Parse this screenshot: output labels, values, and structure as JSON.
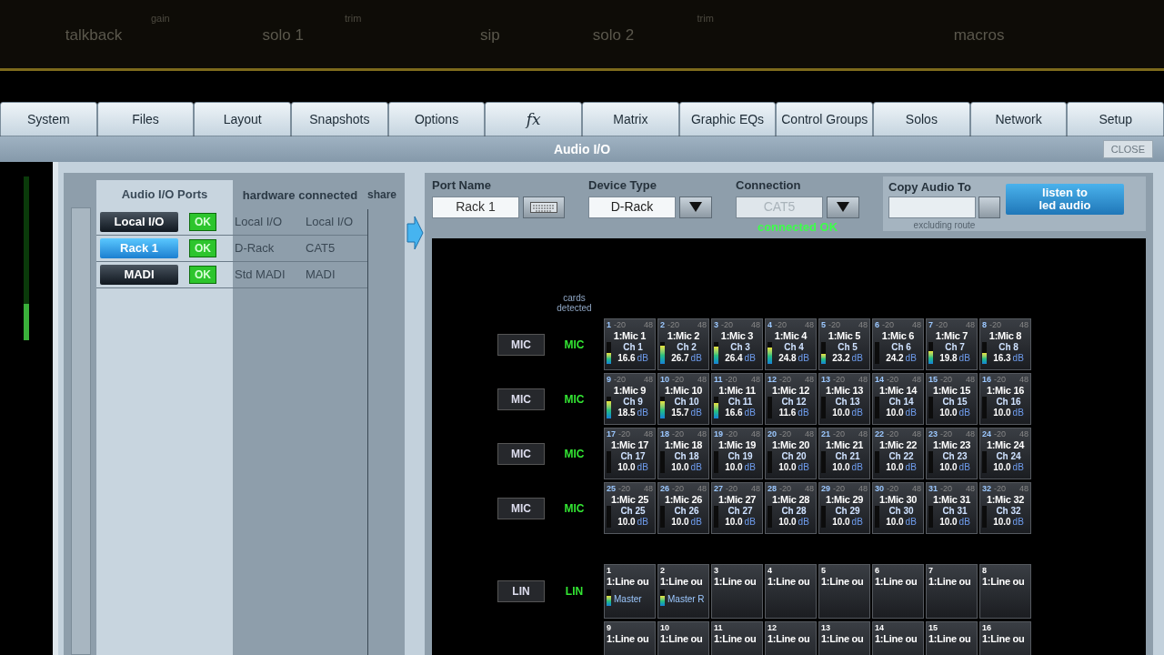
{
  "bezel": {
    "labels": [
      {
        "text": "talkback",
        "kind": "main"
      },
      {
        "text": "gain",
        "kind": "small"
      },
      {
        "text": "solo 1",
        "kind": "main"
      },
      {
        "text": "trim",
        "kind": "small"
      },
      {
        "text": "sip",
        "kind": "main"
      },
      {
        "text": "solo 2",
        "kind": "main"
      },
      {
        "text": "trim",
        "kind": "small"
      },
      {
        "text": "macros",
        "kind": "main"
      }
    ]
  },
  "tabs": [
    {
      "label": "System",
      "selected": false
    },
    {
      "label": "Files",
      "selected": false
    },
    {
      "label": "Layout",
      "selected": false
    },
    {
      "label": "Snapshots",
      "selected": false
    },
    {
      "label": "Options",
      "selected": false
    },
    {
      "label": "fx",
      "selected": false,
      "kind": "italic"
    },
    {
      "label": "Matrix",
      "selected": false
    },
    {
      "label": "Graphic EQs",
      "selected": false
    },
    {
      "label": "Control Groups",
      "selected": false
    },
    {
      "label": "Solos",
      "selected": false
    },
    {
      "label": "Network",
      "selected": false
    },
    {
      "label": "Setup",
      "selected": false
    }
  ],
  "window": {
    "title": "Audio I/O",
    "close": "CLOSE"
  },
  "ports": {
    "columns": [
      "Audio I/O Ports",
      "hardware connected",
      "share"
    ],
    "rows": [
      {
        "name": "Local I/O",
        "selected": false,
        "status": "OK",
        "device": "Local I/O",
        "connection": "Local I/O"
      },
      {
        "name": "Rack 1",
        "selected": true,
        "status": "OK",
        "device": "D-Rack",
        "connection": "CAT5"
      },
      {
        "name": "MADI",
        "selected": false,
        "status": "OK",
        "device": "Std MADI",
        "connection": "MADI"
      }
    ]
  },
  "port_name": {
    "label": "Port Name",
    "value": "Rack 1"
  },
  "device_type": {
    "label": "Device Type",
    "value": "D-Rack"
  },
  "connection": {
    "label": "Connection",
    "value": "CAT5",
    "disabled": true,
    "status": "connected OK"
  },
  "copy_audio_to": {
    "label": "Copy Audio To",
    "note": "excluding route"
  },
  "listen_button": {
    "lines": [
      "listen to",
      "led audio"
    ]
  },
  "cards_detected": "cards detected",
  "mic_rows": [
    {
      "button": "MIC",
      "detected": "MIC",
      "tiles": [
        {
          "num": "1",
          "low": "-20",
          "high": "48",
          "name": "1:Mic 1",
          "ch": "Ch 1",
          "value": "16.6",
          "unit": "dB",
          "level": 0.5
        },
        {
          "num": "2",
          "low": "-20",
          "high": "48",
          "name": "1:Mic 2",
          "ch": "Ch 2",
          "value": "26.7",
          "unit": "dB",
          "level": 0.85
        },
        {
          "num": "3",
          "low": "-20",
          "high": "48",
          "name": "1:Mic 3",
          "ch": "Ch 3",
          "value": "26.4",
          "unit": "dB",
          "level": 0.8
        },
        {
          "num": "4",
          "low": "-20",
          "high": "48",
          "name": "1:Mic 4",
          "ch": "Ch 4",
          "value": "24.8",
          "unit": "dB",
          "level": 0.75
        },
        {
          "num": "5",
          "low": "-20",
          "high": "48",
          "name": "1:Mic 5",
          "ch": "Ch 5",
          "value": "23.2",
          "unit": "dB",
          "level": 0.45
        },
        {
          "num": "6",
          "low": "-20",
          "high": "48",
          "name": "1:Mic 6",
          "ch": "Ch 6",
          "value": "24.2",
          "unit": "dB"
        },
        {
          "num": "7",
          "low": "-20",
          "high": "48",
          "name": "1:Mic 7",
          "ch": "Ch 7",
          "value": "19.8",
          "unit": "dB",
          "level": 0.6
        },
        {
          "num": "8",
          "low": "-20",
          "high": "48",
          "name": "1:Mic 8",
          "ch": "Ch 8",
          "value": "16.3",
          "unit": "dB",
          "level": 0.5
        }
      ]
    },
    {
      "button": "MIC",
      "detected": "MIC",
      "tiles": [
        {
          "num": "9",
          "low": "-20",
          "high": "48",
          "name": "1:Mic 9",
          "ch": "Ch 9",
          "value": "18.5",
          "unit": "dB",
          "level": 0.8
        },
        {
          "num": "10",
          "low": "-20",
          "high": "48",
          "name": "1:Mic 10",
          "ch": "Ch 10",
          "value": "15.7",
          "unit": "dB",
          "level": 0.8
        },
        {
          "num": "11",
          "low": "-20",
          "high": "48",
          "name": "1:Mic 11",
          "ch": "Ch 11",
          "value": "16.6",
          "unit": "dB",
          "level": 0.7
        },
        {
          "num": "12",
          "low": "-20",
          "high": "48",
          "name": "1:Mic 12",
          "ch": "Ch 12",
          "value": "11.6",
          "unit": "dB"
        },
        {
          "num": "13",
          "low": "-20",
          "high": "48",
          "name": "1:Mic 13",
          "ch": "Ch 13",
          "value": "10.0",
          "unit": "dB"
        },
        {
          "num": "14",
          "low": "-20",
          "high": "48",
          "name": "1:Mic 14",
          "ch": "Ch 14",
          "value": "10.0",
          "unit": "dB"
        },
        {
          "num": "15",
          "low": "-20",
          "high": "48",
          "name": "1:Mic 15",
          "ch": "Ch 15",
          "value": "10.0",
          "unit": "dB"
        },
        {
          "num": "16",
          "low": "-20",
          "high": "48",
          "name": "1:Mic 16",
          "ch": "Ch 16",
          "value": "10.0",
          "unit": "dB"
        }
      ]
    },
    {
      "button": "MIC",
      "detected": "MIC",
      "tiles": [
        {
          "num": "17",
          "low": "-20",
          "high": "48",
          "name": "1:Mic 17",
          "ch": "Ch 17",
          "value": "10.0",
          "unit": "dB"
        },
        {
          "num": "18",
          "low": "-20",
          "high": "48",
          "name": "1:Mic 18",
          "ch": "Ch 18",
          "value": "10.0",
          "unit": "dB"
        },
        {
          "num": "19",
          "low": "-20",
          "high": "48",
          "name": "1:Mic 19",
          "ch": "Ch 19",
          "value": "10.0",
          "unit": "dB"
        },
        {
          "num": "20",
          "low": "-20",
          "high": "48",
          "name": "1:Mic 20",
          "ch": "Ch 20",
          "value": "10.0",
          "unit": "dB"
        },
        {
          "num": "21",
          "low": "-20",
          "high": "48",
          "name": "1:Mic 21",
          "ch": "Ch 21",
          "value": "10.0",
          "unit": "dB"
        },
        {
          "num": "22",
          "low": "-20",
          "high": "48",
          "name": "1:Mic 22",
          "ch": "Ch 22",
          "value": "10.0",
          "unit": "dB"
        },
        {
          "num": "23",
          "low": "-20",
          "high": "48",
          "name": "1:Mic 23",
          "ch": "Ch 23",
          "value": "10.0",
          "unit": "dB"
        },
        {
          "num": "24",
          "low": "-20",
          "high": "48",
          "name": "1:Mic 24",
          "ch": "Ch 24",
          "value": "10.0",
          "unit": "dB"
        }
      ]
    },
    {
      "button": "MIC",
      "detected": "MIC",
      "tiles": [
        {
          "num": "25",
          "low": "-20",
          "high": "48",
          "name": "1:Mic 25",
          "ch": "Ch 25",
          "value": "10.0",
          "unit": "dB"
        },
        {
          "num": "26",
          "low": "-20",
          "high": "48",
          "name": "1:Mic 26",
          "ch": "Ch 26",
          "value": "10.0",
          "unit": "dB"
        },
        {
          "num": "27",
          "low": "-20",
          "high": "48",
          "name": "1:Mic 27",
          "ch": "Ch 27",
          "value": "10.0",
          "unit": "dB"
        },
        {
          "num": "28",
          "low": "-20",
          "high": "48",
          "name": "1:Mic 28",
          "ch": "Ch 28",
          "value": "10.0",
          "unit": "dB"
        },
        {
          "num": "29",
          "low": "-20",
          "high": "48",
          "name": "1:Mic 29",
          "ch": "Ch 29",
          "value": "10.0",
          "unit": "dB"
        },
        {
          "num": "30",
          "low": "-20",
          "high": "48",
          "name": "1:Mic 30",
          "ch": "Ch 30",
          "value": "10.0",
          "unit": "dB"
        },
        {
          "num": "31",
          "low": "-20",
          "high": "48",
          "name": "1:Mic 31",
          "ch": "Ch 31",
          "value": "10.0",
          "unit": "dB"
        },
        {
          "num": "32",
          "low": "-20",
          "high": "48",
          "name": "1:Mic 32",
          "ch": "Ch 32",
          "value": "10.0",
          "unit": "dB"
        }
      ]
    }
  ],
  "line_rows": [
    {
      "button": "LIN",
      "detected": "LIN",
      "tiles": [
        {
          "num": "1",
          "name": "1:Line ou",
          "bus": "Master",
          "level": 0.6
        },
        {
          "num": "2",
          "name": "1:Line ou",
          "bus": "Master R",
          "level": 0.6
        },
        {
          "num": "3",
          "name": "1:Line ou"
        },
        {
          "num": "4",
          "name": "1:Line ou"
        },
        {
          "num": "5",
          "name": "1:Line ou"
        },
        {
          "num": "6",
          "name": "1:Line ou"
        },
        {
          "num": "7",
          "name": "1:Line ou"
        },
        {
          "num": "8",
          "name": "1:Line ou"
        }
      ]
    },
    {
      "tiles": [
        {
          "num": "9",
          "name": "1:Line ou"
        },
        {
          "num": "10",
          "name": "1:Line ou"
        },
        {
          "num": "11",
          "name": "1:Line ou"
        },
        {
          "num": "12",
          "name": "1:Line ou"
        },
        {
          "num": "13",
          "name": "1:Line ou"
        },
        {
          "num": "14",
          "name": "1:Line ou"
        },
        {
          "num": "15",
          "name": "1:Line ou"
        },
        {
          "num": "16",
          "name": "1:Line ou"
        }
      ]
    }
  ]
}
